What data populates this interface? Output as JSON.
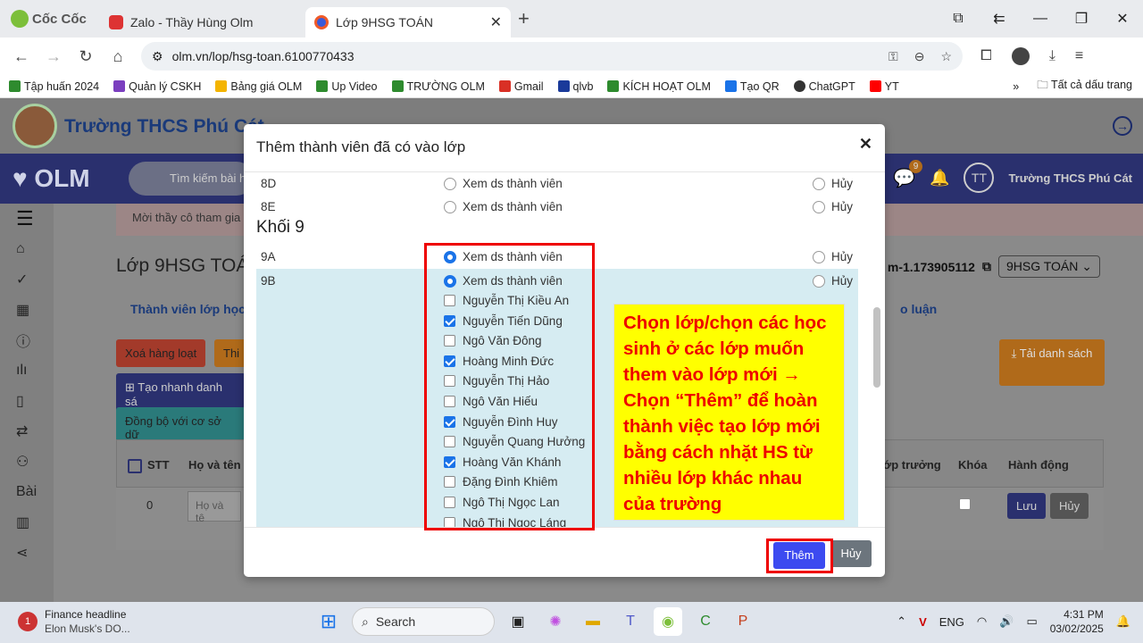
{
  "browser": {
    "brand": "Cốc Cốc",
    "tabs": [
      {
        "label": "Zalo - Thầy Hùng Olm",
        "active": false
      },
      {
        "label": "Lớp 9HSG TOÁN",
        "active": true
      }
    ],
    "url": "olm.vn/lop/hsg-toan.6100770433",
    "bookmarks": [
      {
        "label": "Tập huấn 2024",
        "color": "#2e8b2e"
      },
      {
        "label": "Quản lý CSKH",
        "color": "#7b3fbf"
      },
      {
        "label": "Bảng giá OLM",
        "color": "#f4b400"
      },
      {
        "label": "Up Video",
        "color": "#2e8b2e"
      },
      {
        "label": "TRƯỜNG OLM",
        "color": "#2e8b2e"
      },
      {
        "label": "Gmail",
        "color": "#d93025"
      },
      {
        "label": "qlvb",
        "color": "#1a3a9a"
      },
      {
        "label": "KÍCH HOẠT OLM",
        "color": "#2e8b2e"
      },
      {
        "label": "Tạo QR",
        "color": "#1a73e8"
      },
      {
        "label": "ChatGPT",
        "color": "#333333"
      },
      {
        "label": "YT",
        "color": "#ff0000"
      }
    ],
    "all_bookmarks": "Tất cả dấu trang"
  },
  "site": {
    "school_name": "Trường THCS Phú Cát",
    "olm_logo": "OLM",
    "search_placeholder": "Tìm kiếm bài h",
    "notification_count": "9",
    "avatar_initials": "TT",
    "user_name": "Trường THCS Phú Cát",
    "notice": "Mời thầy cô tham gia",
    "page_title": "Lớp 9HSG TOÁ",
    "class_code": "m-1.173905112",
    "class_select": "9HSG TOÁN",
    "tab_members": "Thành viên lớp học",
    "tab_discussion": "o luận",
    "btn_bulk_delete": "Xoá hàng loạt",
    "btn_thi": "Thi",
    "btn_quick_create": "Tạo nhanh danh sá",
    "btn_sync": "Đồng bộ với cơ sở dữ",
    "btn_download": "Tải danh sách",
    "table_headers": {
      "stt": "STT",
      "name": "Họ và tên",
      "monitor": "ớp trưởng",
      "lock": "Khóa",
      "action": "Hành động"
    },
    "row_stt": "0",
    "row_name_placeholder": "Họ và tê",
    "btn_save": "Lưu",
    "btn_cancel": "Hủy",
    "sidebar_label": "Bài"
  },
  "modal": {
    "title": "Thêm thành viên đã có vào lớp",
    "view_label": "Xem ds thành viên",
    "cancel_label": "Hủy",
    "pre_rows": [
      {
        "class": "8D",
        "view": false
      },
      {
        "class": "8E",
        "view": false
      }
    ],
    "grade_heading": "Khối 9",
    "rows": [
      {
        "class": "9A",
        "view": true
      },
      {
        "class": "9B",
        "view": true
      }
    ],
    "students": [
      {
        "name": "Nguyễn Thị Kiều An",
        "checked": false
      },
      {
        "name": "Nguyễn Tiến Dũng",
        "checked": true
      },
      {
        "name": "Ngô Văn Đông",
        "checked": false
      },
      {
        "name": "Hoàng Minh Đức",
        "checked": true
      },
      {
        "name": "Nguyễn Thị Hảo",
        "checked": false
      },
      {
        "name": "Ngô Văn Hiếu",
        "checked": false
      },
      {
        "name": "Nguyễn Đình Huy",
        "checked": true
      },
      {
        "name": "Nguyễn Quang Hưởng",
        "checked": false
      },
      {
        "name": "Hoàng Văn Khánh",
        "checked": true
      },
      {
        "name": "Đặng Đình Khiêm",
        "checked": false
      },
      {
        "name": "Ngô Thị Ngọc Lan",
        "checked": false
      },
      {
        "name": "Ngô Thị Ngọc Láng",
        "checked": false
      }
    ],
    "add_button": "Thêm",
    "cancel_button": "Hủy"
  },
  "annotation": {
    "text": "Chọn lớp/chọn các học sinh ở các lớp muốn them vào lớp mới → Chọn “Thêm” để hoàn thành việc tạo lớp mới bằng cách nhặt HS từ nhiều lớp khác nhau của trường",
    "text_color": "#e00000",
    "bg_color": "#ffff00",
    "box_color": "#e00000"
  },
  "taskbar": {
    "news_title": "Finance headline",
    "news_sub": "Elon Musk's DO...",
    "news_badge": "1",
    "search_label": "Search",
    "lang": "ENG",
    "time": "4:31 PM",
    "date": "03/02/2025"
  }
}
